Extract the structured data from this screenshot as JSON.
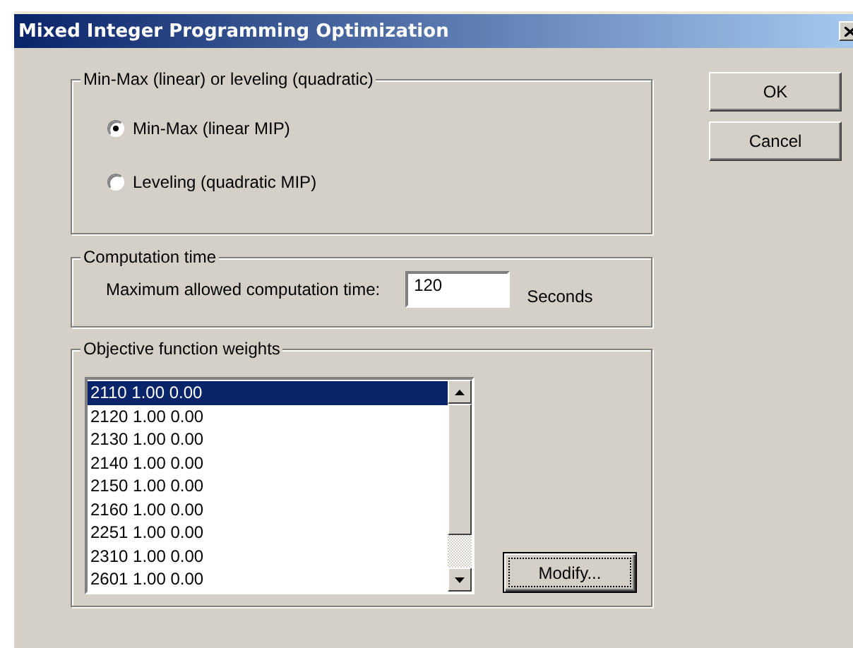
{
  "window": {
    "title": "Mixed Integer Programming Optimization"
  },
  "mode_group": {
    "legend": "Min-Max (linear) or leveling (quadratic)",
    "options": [
      {
        "label": "Min-Max (linear MIP)",
        "selected": true
      },
      {
        "label": "Leveling (quadratic MIP)",
        "selected": false
      }
    ]
  },
  "computation_time": {
    "legend": "Computation time",
    "label": "Maximum allowed computation time:",
    "value": "120",
    "unit": "Seconds"
  },
  "weights": {
    "legend": "Objective function weights",
    "items": [
      {
        "text": "2110 1.00 0.00",
        "selected": true
      },
      {
        "text": "2120 1.00 0.00",
        "selected": false
      },
      {
        "text": "2130 1.00 0.00",
        "selected": false
      },
      {
        "text": "2140 1.00 0.00",
        "selected": false
      },
      {
        "text": "2150 1.00 0.00",
        "selected": false
      },
      {
        "text": "2160 1.00 0.00",
        "selected": false
      },
      {
        "text": "2251 1.00 0.00",
        "selected": false
      },
      {
        "text": "2310 1.00 0.00",
        "selected": false
      },
      {
        "text": "2601 1.00 0.00",
        "selected": false
      }
    ],
    "button": "Modify..."
  },
  "buttons": [
    "OK",
    "Cancel"
  ]
}
